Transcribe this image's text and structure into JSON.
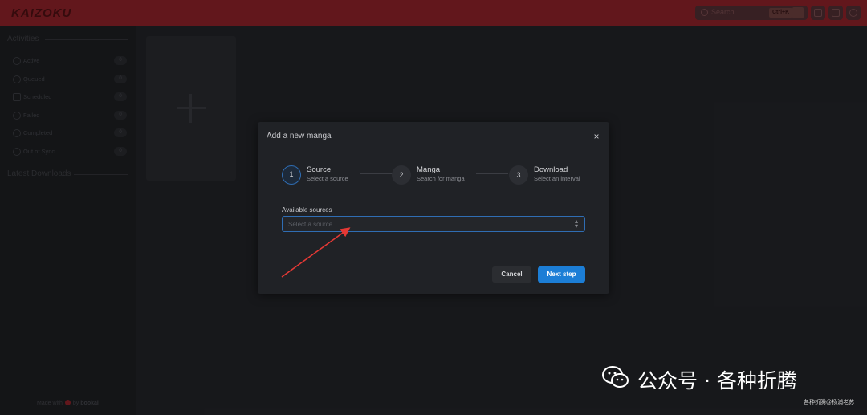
{
  "app": {
    "logo": "KAIZOKU"
  },
  "header": {
    "search_placeholder": "Search",
    "search_shortcut": "Ctrl+K",
    "buttons": [
      "wrench-icon",
      "theme-icon",
      "settings-icon"
    ]
  },
  "sidebar": {
    "activities_title": "Activities",
    "items": [
      {
        "label": "Active",
        "count": "0",
        "icon": "activity-icon"
      },
      {
        "label": "Queued",
        "count": "0",
        "icon": "clock-icon"
      },
      {
        "label": "Scheduled",
        "count": "0",
        "icon": "calendar-icon"
      },
      {
        "label": "Failed",
        "count": "0",
        "icon": "x-circle-icon"
      },
      {
        "label": "Completed",
        "count": "0",
        "icon": "check-circle-icon"
      },
      {
        "label": "Out of Sync",
        "count": "0",
        "icon": "sync-icon"
      }
    ],
    "latest_downloads_title": "Latest Downloads",
    "footer": {
      "made_with": "Made with",
      "by": "by",
      "author": "bookai"
    }
  },
  "modal": {
    "title": "Add a new manga",
    "close_label": "×",
    "steps": [
      {
        "number": "1",
        "title": "Source",
        "description": "Select a source"
      },
      {
        "number": "2",
        "title": "Manga",
        "description": "Search for manga"
      },
      {
        "number": "3",
        "title": "Download",
        "description": "Select an interval"
      }
    ],
    "active_step": 1,
    "field_label": "Available sources",
    "select_placeholder": "Select a source",
    "cancel_label": "Cancel",
    "next_label": "Next step"
  },
  "colors": {
    "header_bg": "#6b1a1f",
    "accent": "#1c7ed6",
    "active_step_border": "#2f6db3",
    "annotation_arrow": "#e53935"
  },
  "watermark": {
    "text": "公众号 · 各种折腾",
    "sub": "各种折腾@杨浦老苏"
  }
}
